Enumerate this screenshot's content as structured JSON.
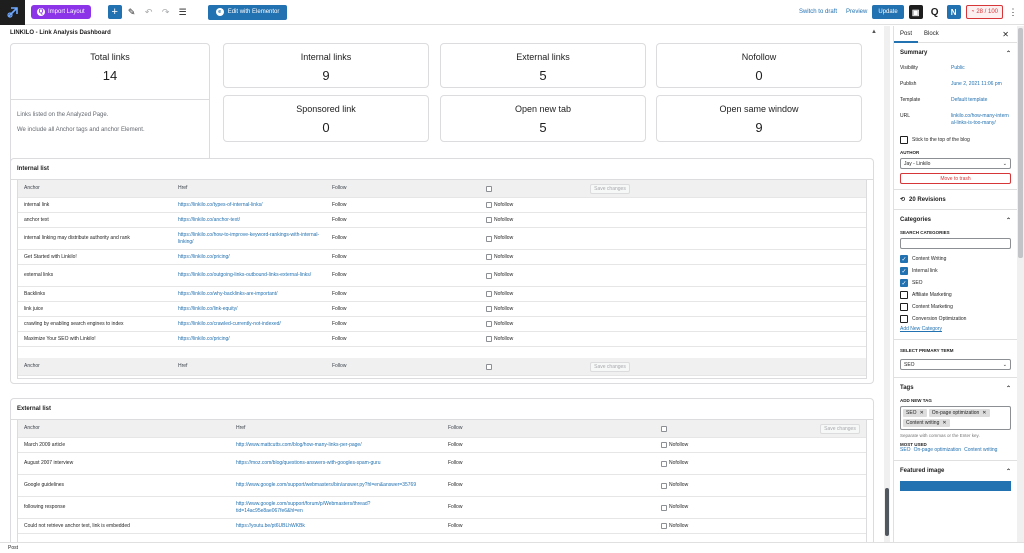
{
  "toolbar": {
    "import_label": "Import Layout",
    "elementor_label": "Edit with Elementor",
    "switch_draft": "Switch to draft",
    "preview": "Preview",
    "update": "Update",
    "score": "28 / 100",
    "q_label": "Q",
    "n_label": "N"
  },
  "dashboard": {
    "title": "LINKILO - Link Analysis Dashboard",
    "total_label": "Total links",
    "total_value": "14",
    "desc_line1": "Links listed on the Analyzed Page.",
    "desc_line2": "We include all Anchor tags and anchor Element.",
    "cards": [
      {
        "label": "Internal links",
        "value": "9"
      },
      {
        "label": "External links",
        "value": "5"
      },
      {
        "label": "Nofollow",
        "value": "0"
      },
      {
        "label": "Sponsored link",
        "value": "0"
      },
      {
        "label": "Open new tab",
        "value": "5"
      },
      {
        "label": "Open same window",
        "value": "9"
      }
    ]
  },
  "internal": {
    "title": "Internal list",
    "headers": {
      "anchor": "Anchor",
      "href": "Href",
      "follow": "Follow",
      "save": "Save changes"
    },
    "rows": [
      {
        "anchor": "internal link",
        "href": "https://linkilo.co/types-of-internal-links/",
        "follow": "Follow",
        "nofollow": "Nofollow"
      },
      {
        "anchor": "anchor text",
        "href": "https://linkilo.co/anchor-text/",
        "follow": "Follow",
        "nofollow": "Nofollow"
      },
      {
        "anchor": "internal linking may distribute authority and rank",
        "href": "https://linkilo.co/how-to-improve-keyword-rankings-with-internal-linking/",
        "follow": "Follow",
        "nofollow": "Nofollow"
      },
      {
        "anchor": "Get Started with Linkilo!",
        "href": "https://linkilo.co/pricing/",
        "follow": "Follow",
        "nofollow": "Nofollow"
      },
      {
        "anchor": "external links",
        "href": "https://linkilo.co/outgoing-links-outbound-links-external-links/",
        "follow": "Follow",
        "nofollow": "Nofollow"
      },
      {
        "anchor": "Backlinks",
        "href": "https://linkilo.co/why-backlinks-are-important/",
        "follow": "Follow",
        "nofollow": "Nofollow"
      },
      {
        "anchor": "link juice",
        "href": "https://linkilo.co/link-equity/",
        "follow": "Follow",
        "nofollow": "Nofollow"
      },
      {
        "anchor": "crawling by enabling search engines to index",
        "href": "https://linkilo.co/crawled-currently-not-indexed/",
        "follow": "Follow",
        "nofollow": "Nofollow"
      },
      {
        "anchor": "Maximize Your SEO with Linkilo!",
        "href": "https://linkilo.co/pricing/",
        "follow": "Follow",
        "nofollow": "Nofollow"
      }
    ]
  },
  "external": {
    "title": "External list",
    "headers": {
      "anchor": "Anchor",
      "href": "Href",
      "follow": "Follow",
      "save": "Save changes"
    },
    "rows": [
      {
        "anchor": "March 2009 article",
        "href": "http://www.mattcutts.com/blog/how-many-links-per-page/",
        "follow": "Follow",
        "nofollow": "Nofollow"
      },
      {
        "anchor": "August 2007 interview",
        "href": "https://moz.com/blog/questions-answers-with-googles-spam-guru",
        "follow": "Follow",
        "nofollow": "Nofollow"
      },
      {
        "anchor": "Google guidelines",
        "href": "http://www.google.com/support/webmasters/bin/answer.py?hl=en&answer=35769",
        "follow": "Follow",
        "nofollow": "Nofollow"
      },
      {
        "anchor": "following response",
        "href": "http://www.google.com/support/forum/p/Webmasters/thread?tid=14ac95e8ae067fe6&hl=en",
        "follow": "Follow",
        "nofollow": "Nofollow"
      },
      {
        "anchor": "Could not retrieve anchor text, link is embedded",
        "href": "https://youtu.be/pt6UBLhWKBk",
        "follow": "Follow",
        "nofollow": "Nofollow"
      }
    ]
  },
  "sidebar": {
    "tab_post": "Post",
    "tab_block": "Block",
    "summary": "Summary",
    "visibility_label": "Visibility",
    "visibility_value": "Public",
    "publish_label": "Publish",
    "publish_value": "June 2, 2021 11:06 pm",
    "template_label": "Template",
    "template_value": "Default template",
    "url_label": "URL",
    "url_value": "linkilo.co/how-many-internal-links-is-too-many/",
    "stick_label": "Stick to the top of the blog",
    "author_label": "AUTHOR",
    "author_value": "Jay - Linkilo",
    "trash_label": "Move to trash",
    "revisions": "20 Revisions",
    "categories_label": "Categories",
    "search_categories": "SEARCH CATEGORIES",
    "categories": [
      {
        "name": "Content Writing",
        "checked": true
      },
      {
        "name": "Internal link",
        "checked": true
      },
      {
        "name": "SEO",
        "checked": true
      },
      {
        "name": "Affiliate Marketing",
        "checked": false
      },
      {
        "name": "Content Marketing",
        "checked": false
      },
      {
        "name": "Conversion Optimization",
        "checked": false
      }
    ],
    "add_category": "Add New Category",
    "primary_term_label": "SELECT PRIMARY TERM",
    "primary_term_value": "SEO",
    "tags_label": "Tags",
    "add_tag_label": "ADD NEW TAG",
    "tags": [
      "SEO",
      "On-page optimization",
      "Content writing"
    ],
    "tag_hint": "Separate with commas or the Enter key.",
    "most_used": "MOST USED",
    "most_used_tags": [
      "SEO",
      "On-page optimization",
      "Content writing"
    ],
    "featured_image": "Featured image"
  },
  "footer": {
    "label": "Post"
  }
}
